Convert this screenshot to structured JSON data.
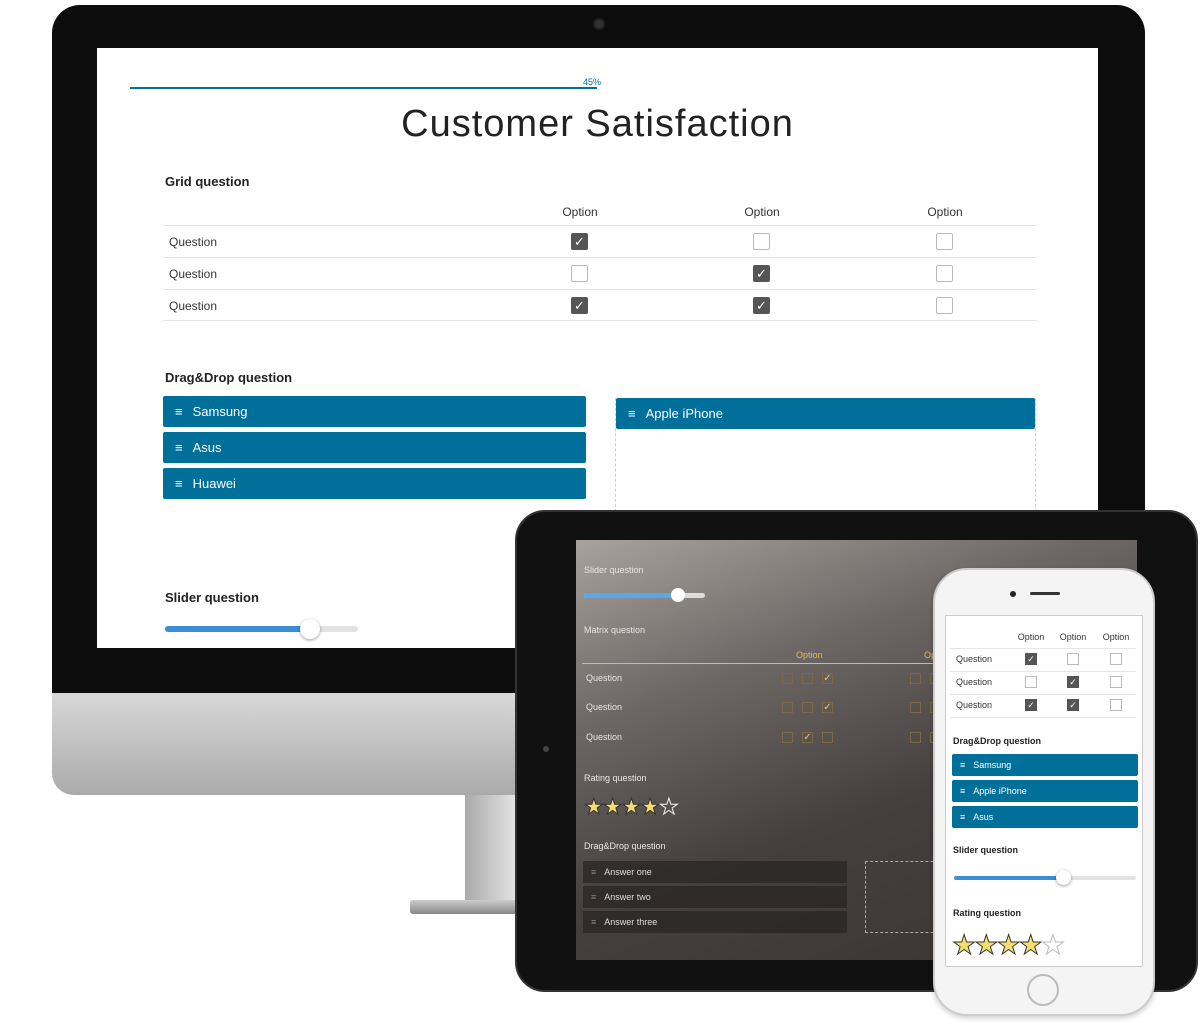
{
  "desktop": {
    "progress": {
      "value_percent": 45,
      "label": "45%",
      "color": "#00709b"
    },
    "title": "Customer Satisfaction",
    "grid": {
      "label": "Grid question",
      "columns": [
        "Option",
        "Option",
        "Option"
      ],
      "rows": [
        {
          "label": "Question",
          "checked": [
            true,
            false,
            false
          ]
        },
        {
          "label": "Question",
          "checked": [
            false,
            true,
            false
          ]
        },
        {
          "label": "Question",
          "checked": [
            true,
            true,
            false
          ]
        }
      ]
    },
    "dragdrop": {
      "label": "Drag&Drop question",
      "source": [
        "Samsung",
        "Asus",
        "Huawei"
      ],
      "target": [
        "Apple iPhone"
      ]
    },
    "slider": {
      "label": "Slider question",
      "value_percent": 75
    }
  },
  "tablet": {
    "slider": {
      "label": "Slider question",
      "value_percent": 78
    },
    "matrix": {
      "label": "Matrix question",
      "columns": [
        "Option",
        "Op"
      ],
      "rows": [
        {
          "label": "Question",
          "checked": [
            false,
            false,
            true
          ]
        },
        {
          "label": "Question",
          "checked": [
            false,
            false,
            true
          ]
        },
        {
          "label": "Question",
          "checked": [
            false,
            true,
            false
          ]
        }
      ]
    },
    "rating": {
      "label": "Rating question",
      "value": 4,
      "max": 5
    },
    "dragdrop": {
      "label": "Drag&Drop question",
      "items": [
        "Answer one",
        "Answer two",
        "Answer three"
      ]
    }
  },
  "phone": {
    "grid": {
      "columns": [
        "Option",
        "Option",
        "Option"
      ],
      "rows": [
        {
          "label": "Question",
          "checked": [
            true,
            false,
            false
          ]
        },
        {
          "label": "Question",
          "checked": [
            false,
            true,
            false
          ]
        },
        {
          "label": "Question",
          "checked": [
            true,
            true,
            false
          ]
        }
      ]
    },
    "dragdrop": {
      "label": "Drag&Drop question",
      "items": [
        "Samsung",
        "Apple iPhone",
        "Asus"
      ]
    },
    "slider": {
      "label": "Slider question",
      "value_percent": 60
    },
    "rating": {
      "label": "Rating question",
      "value": 4,
      "max": 5
    }
  },
  "icons": {
    "drag_handle": "hamburger-icon",
    "check": "checkmark-icon",
    "star": "star-icon"
  },
  "colors": {
    "accent": "#00709b",
    "slider": "#3a8dd6",
    "star": "#f7dc6f"
  }
}
